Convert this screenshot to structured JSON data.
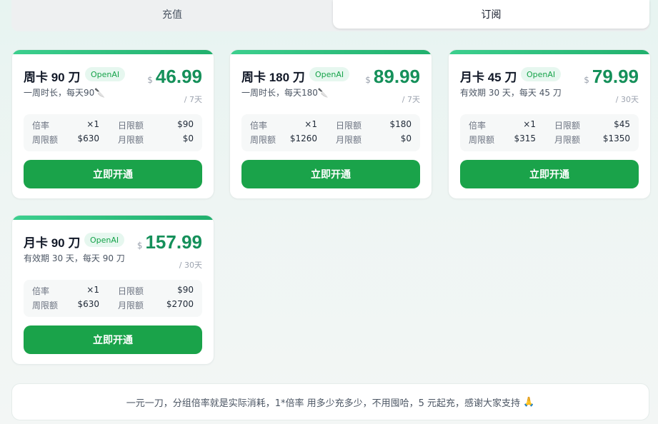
{
  "tabs": [
    {
      "label": "充值",
      "active": false
    },
    {
      "label": "订阅",
      "active": true
    }
  ],
  "plans": [
    {
      "title": "周卡 90 刀",
      "badge": "OpenAI",
      "desc": "一周时长，每天90🔪",
      "currency": "$",
      "price": "46.99",
      "period": "/ 7天",
      "limits": {
        "rate_label": "倍率",
        "rate": "×1",
        "daily_label": "日限额",
        "daily": "$90",
        "weekly_label": "周限额",
        "weekly": "$630",
        "monthly_label": "月限额",
        "monthly": "$0"
      },
      "button": "立即开通"
    },
    {
      "title": "周卡 180 刀",
      "badge": "OpenAI",
      "desc": "一周时长，每天180🔪",
      "currency": "$",
      "price": "89.99",
      "period": "/ 7天",
      "limits": {
        "rate_label": "倍率",
        "rate": "×1",
        "daily_label": "日限额",
        "daily": "$180",
        "weekly_label": "周限额",
        "weekly": "$1260",
        "monthly_label": "月限额",
        "monthly": "$0"
      },
      "button": "立即开通"
    },
    {
      "title": "月卡 45 刀",
      "badge": "OpenAI",
      "desc": "有效期 30 天，每天 45 刀",
      "currency": "$",
      "price": "79.99",
      "period": "/ 30天",
      "limits": {
        "rate_label": "倍率",
        "rate": "×1",
        "daily_label": "日限额",
        "daily": "$45",
        "weekly_label": "周限额",
        "weekly": "$315",
        "monthly_label": "月限额",
        "monthly": "$1350"
      },
      "button": "立即开通"
    },
    {
      "title": "月卡 90 刀",
      "badge": "OpenAI",
      "desc": "有效期 30 天，每天 90 刀",
      "currency": "$",
      "price": "157.99",
      "period": "/ 30天",
      "limits": {
        "rate_label": "倍率",
        "rate": "×1",
        "daily_label": "日限额",
        "daily": "$90",
        "weekly_label": "周限额",
        "weekly": "$630",
        "monthly_label": "月限额",
        "monthly": "$2700"
      },
      "button": "立即开通"
    }
  ],
  "footer": {
    "text": "一元一刀，分组倍率就是实际消耗，1*倍率 用多少充多少，不用囤哈，5 元起充，感谢大家支持",
    "icon": "pray-hands-icon",
    "emoji": "🙏"
  },
  "colors": {
    "accent_green": "#1aa34a",
    "price_green": "#15905a",
    "badge_bg": "#e6f7ef"
  }
}
